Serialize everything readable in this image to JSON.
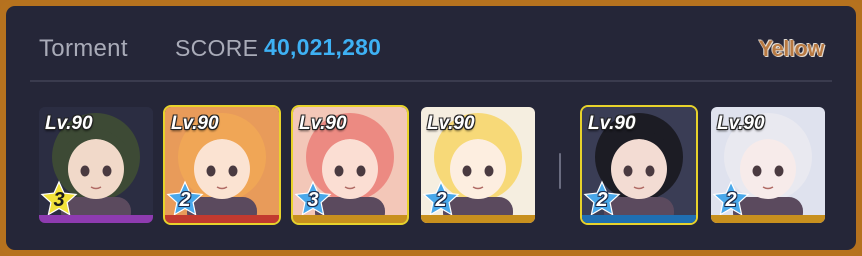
{
  "header": {
    "mode": "Torment",
    "score_label": "SCORE",
    "score_value": "40,021,280",
    "team_name": "Yellow"
  },
  "strikers": [
    {
      "level": "Lv.90",
      "star": "3",
      "star_color": "#f2e23a",
      "bar_color": "#8e3bb0",
      "selected": false,
      "hair": "#3d4a35",
      "skin": "#f1d9c9",
      "bg": "#2b2d42"
    },
    {
      "level": "Lv.90",
      "star": "2",
      "star_color": "#49a8ea",
      "bar_color": "#c23a2f",
      "selected": true,
      "hair": "#f0a656",
      "skin": "#fbe3d2",
      "bg": "#e89b5a"
    },
    {
      "level": "Lv.90",
      "star": "3",
      "star_color": "#49a8ea",
      "bar_color": "#c8901e",
      "selected": true,
      "hair": "#ec8a82",
      "skin": "#fbded3",
      "bg": "#f3c7b8"
    },
    {
      "level": "Lv.90",
      "star": "2",
      "star_color": "#49a8ea",
      "bar_color": "#c8901e",
      "selected": false,
      "hair": "#f7d978",
      "skin": "#fdeee0",
      "bg": "#f5eee0"
    }
  ],
  "specials": [
    {
      "level": "Lv.90",
      "star": "2",
      "star_color": "#49a8ea",
      "bar_color": "#1f6fb2",
      "selected": true,
      "hair": "#1c1c24",
      "skin": "#f3dcd3",
      "bg": "#3a3d55"
    },
    {
      "level": "Lv.90",
      "star": "2",
      "star_color": "#49a8ea",
      "bar_color": "#c8901e",
      "selected": false,
      "hair": "#e9e9f0",
      "skin": "#f7ebea",
      "bg": "#dfe2ee"
    }
  ]
}
